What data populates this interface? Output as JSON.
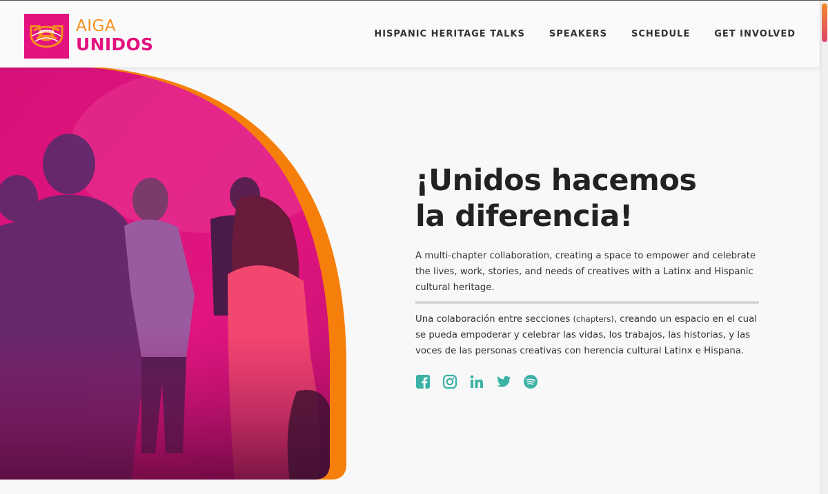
{
  "brand": {
    "aiga": "AIGA",
    "unidos": "UNIDOS",
    "pink": "#e3127f",
    "orange": "#f6901e"
  },
  "nav": {
    "items": [
      {
        "label": "HISPANIC HERITAGE TALKS"
      },
      {
        "label": "SPEAKERS"
      },
      {
        "label": "SCHEDULE"
      },
      {
        "label": "GET INVOLVED"
      }
    ]
  },
  "hero": {
    "title_line1": "¡Unidos hacemos",
    "title_line2": "la diferencia!",
    "description": "A multi-chapter collaboration, creating a space to empower and celebrate the lives, work, stories, and needs of creatives with a Latinx and Hispanic cultural heritage.",
    "description_es_part1": "Una colaboración entre secciones ",
    "description_es_small": "(chapters)",
    "description_es_part2": ", creando un espacio en el cual se pueda empoderar y celebrar las vidas, los trabajos, las historias, y las voces de las personas creativas con herencia cultural Latinx e Hispana."
  },
  "social": {
    "color": "#3bb2a5",
    "icons": [
      "facebook-icon",
      "instagram-icon",
      "linkedin-icon",
      "twitter-icon",
      "spotify-icon"
    ]
  }
}
